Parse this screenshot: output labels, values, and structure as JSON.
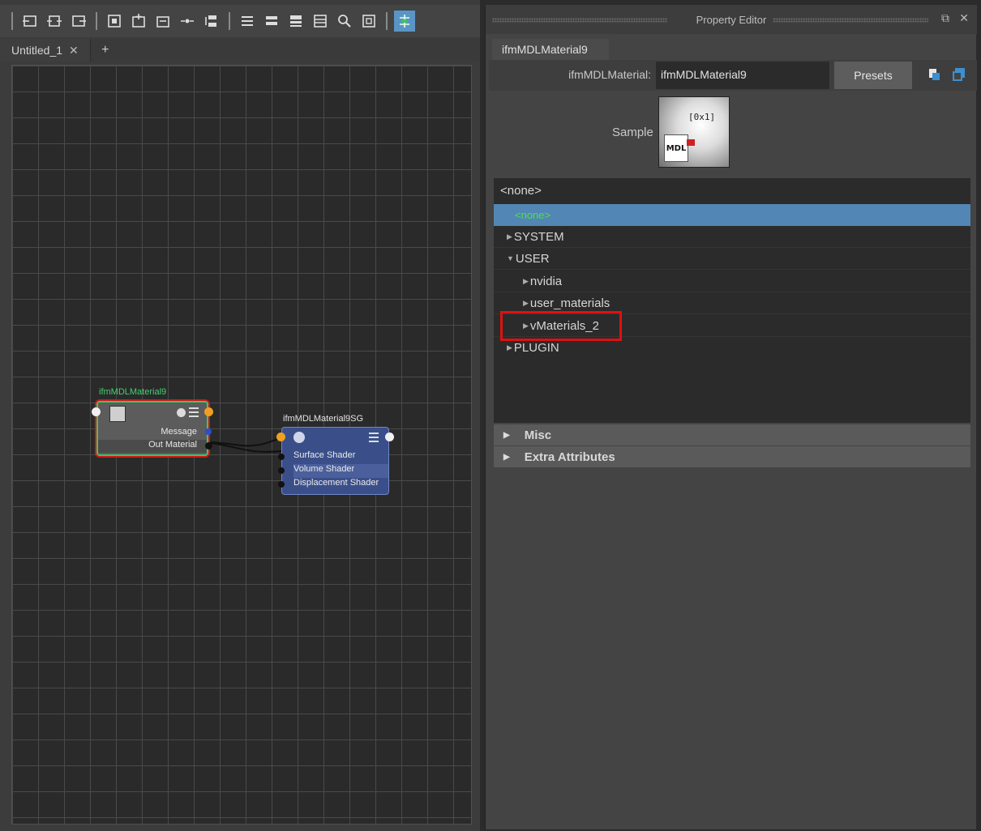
{
  "node_editor": {
    "toolbar": {
      "icons": [
        "graph-input-icon",
        "graph-input-output-icon",
        "graph-output-icon",
        "frame-all-icon",
        "add-node-icon",
        "remove-node-icon",
        "pin-icon",
        "layout-icon",
        "simple-mode-icon",
        "connected-mode-icon",
        "full-mode-icon",
        "custom-mode-icon",
        "search-icon",
        "snapshot-icon",
        "grid-snap-icon"
      ],
      "active_icon": "grid-snap-icon"
    },
    "tab": {
      "label": "Untitled_1",
      "close": "✕",
      "add": "+"
    },
    "nodes": {
      "material": {
        "title": "ifmMDLMaterial9",
        "ports": [
          "Message",
          "Out Material"
        ],
        "title_color": "#43d16f"
      },
      "shading_group": {
        "title": "ifmMDLMaterial9SG",
        "ports": [
          "Surface Shader",
          "Volume Shader",
          "Displacement Shader"
        ]
      }
    }
  },
  "property_editor": {
    "window_title": "Property Editor",
    "node_tab": "ifmMDLMaterial9",
    "material_label": "ifmMDLMaterial:",
    "material_value": "ifmMDLMaterial9",
    "presets": "Presets",
    "sample_label": "Sample",
    "swatch_text": "[0x1]",
    "swatch_badge": "MDL",
    "list": {
      "header": "<none>",
      "selected": "<none>",
      "items": [
        "SYSTEM",
        "USER",
        "nvidia",
        "user_materials",
        "vMaterials_2",
        "PLUGIN"
      ]
    },
    "sections": [
      "Misc",
      "Extra Attributes"
    ]
  },
  "colors": {
    "accent_blue": "#5286b4",
    "selection_green": "#4ae24a",
    "highlight_red": "#e01010",
    "port_orange": "#f0a020"
  }
}
